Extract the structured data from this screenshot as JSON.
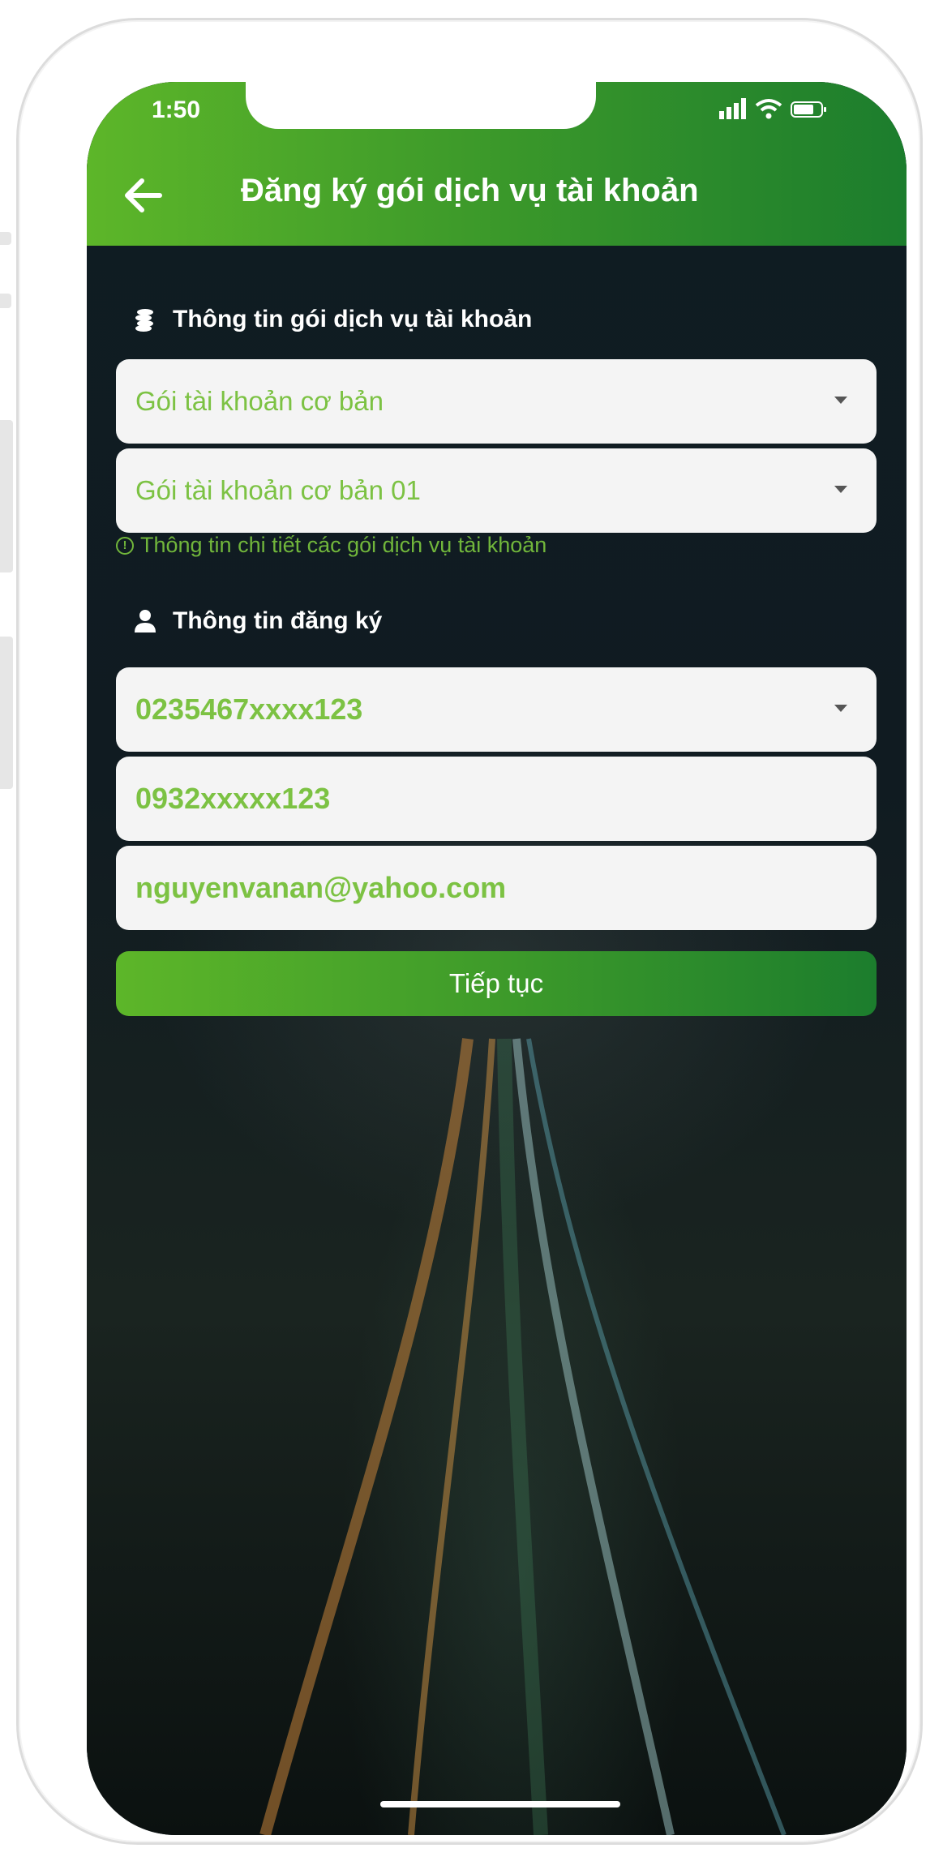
{
  "status_bar": {
    "time": "1:50"
  },
  "header": {
    "title": "Đăng ký gói dịch vụ tài khoản"
  },
  "package_section": {
    "heading": "Thông tin gói dịch vụ tài khoản",
    "package_type": {
      "value": "Gói tài khoản cơ bản"
    },
    "package_name": {
      "value": "Gói tài khoản cơ bản 01"
    },
    "details_link": "Thông tin chi tiết các gói dịch vụ tài khoản"
  },
  "registration_section": {
    "heading": "Thông tin đăng ký",
    "account_number": {
      "value": "0235467xxxx123"
    },
    "phone": {
      "value": "0932xxxxx123"
    },
    "email": {
      "value": "nguyenvanan@yahoo.com"
    }
  },
  "continue_button": {
    "label": "Tiếp tục"
  },
  "colors": {
    "brand_green": "#3e9b2a",
    "text_green": "#7cc243",
    "field_bg": "#f4f4f4"
  },
  "icons": {
    "back": "arrow-left-icon",
    "package_section": "coins-stack-icon",
    "registration_section": "user-icon",
    "info": "info-circle-icon",
    "dropdown": "chevron-down-icon"
  }
}
